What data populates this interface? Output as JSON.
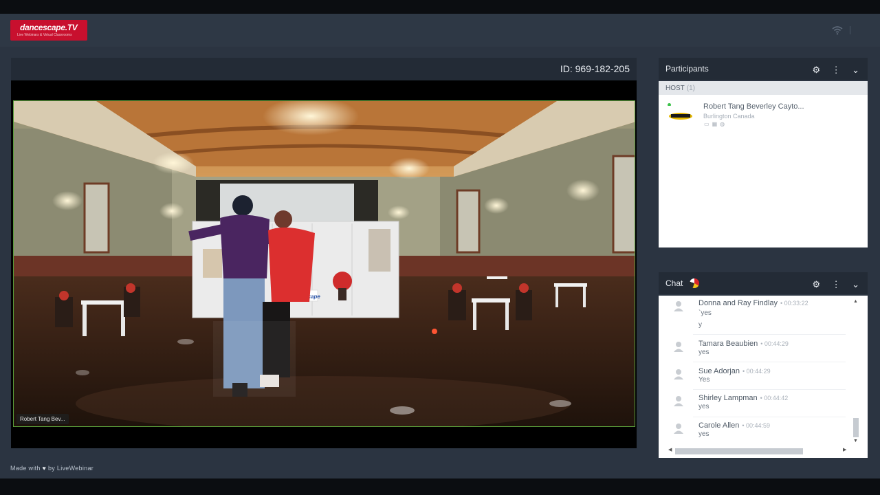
{
  "header": {
    "logo_text": "dancescape.TV",
    "logo_subtitle": "Live Webinars & Virtual Classrooms"
  },
  "stage": {
    "meeting_id": "ID: 969-182-205",
    "video_label": "Robert Tang Bev...",
    "video_scene": {
      "banner_text": "dancescape"
    }
  },
  "footer": {
    "made_with": "Made with",
    "by": "by LiveWebinar"
  },
  "participants": {
    "title": "Participants",
    "host_label": "HOST",
    "host_count": "(1)",
    "items": [
      {
        "name": "Robert Tang Beverley Cayto...",
        "location": "Burlington Canada",
        "online": true
      }
    ]
  },
  "chat": {
    "title": "Chat",
    "messages": [
      {
        "author": "Donna and Ray Findlay",
        "time": "00:33:22",
        "lines": [
          "`yes",
          "y"
        ]
      },
      {
        "author": "Tamara Beaubien",
        "time": "00:44:29",
        "lines": [
          "yes"
        ]
      },
      {
        "author": "Sue Adorjan",
        "time": "00:44:29",
        "lines": [
          "Yes"
        ]
      },
      {
        "author": "Shirley Lampman",
        "time": "00:44:42",
        "lines": [
          "yes"
        ]
      },
      {
        "author": "Carole Allen",
        "time": "00:44:59",
        "lines": [
          "yes"
        ]
      }
    ]
  },
  "icons": {
    "wifi": "wifi-icon",
    "settings": "gear-icon",
    "more": "more-vertical-icon",
    "collapse": "chevron-down-icon",
    "heart": "heart-icon"
  },
  "colors": {
    "background": "#2b3441",
    "panel_header": "#232b36",
    "video_border": "#5a9e3a",
    "logo": "#c8102e",
    "online": "#3cc24a"
  }
}
